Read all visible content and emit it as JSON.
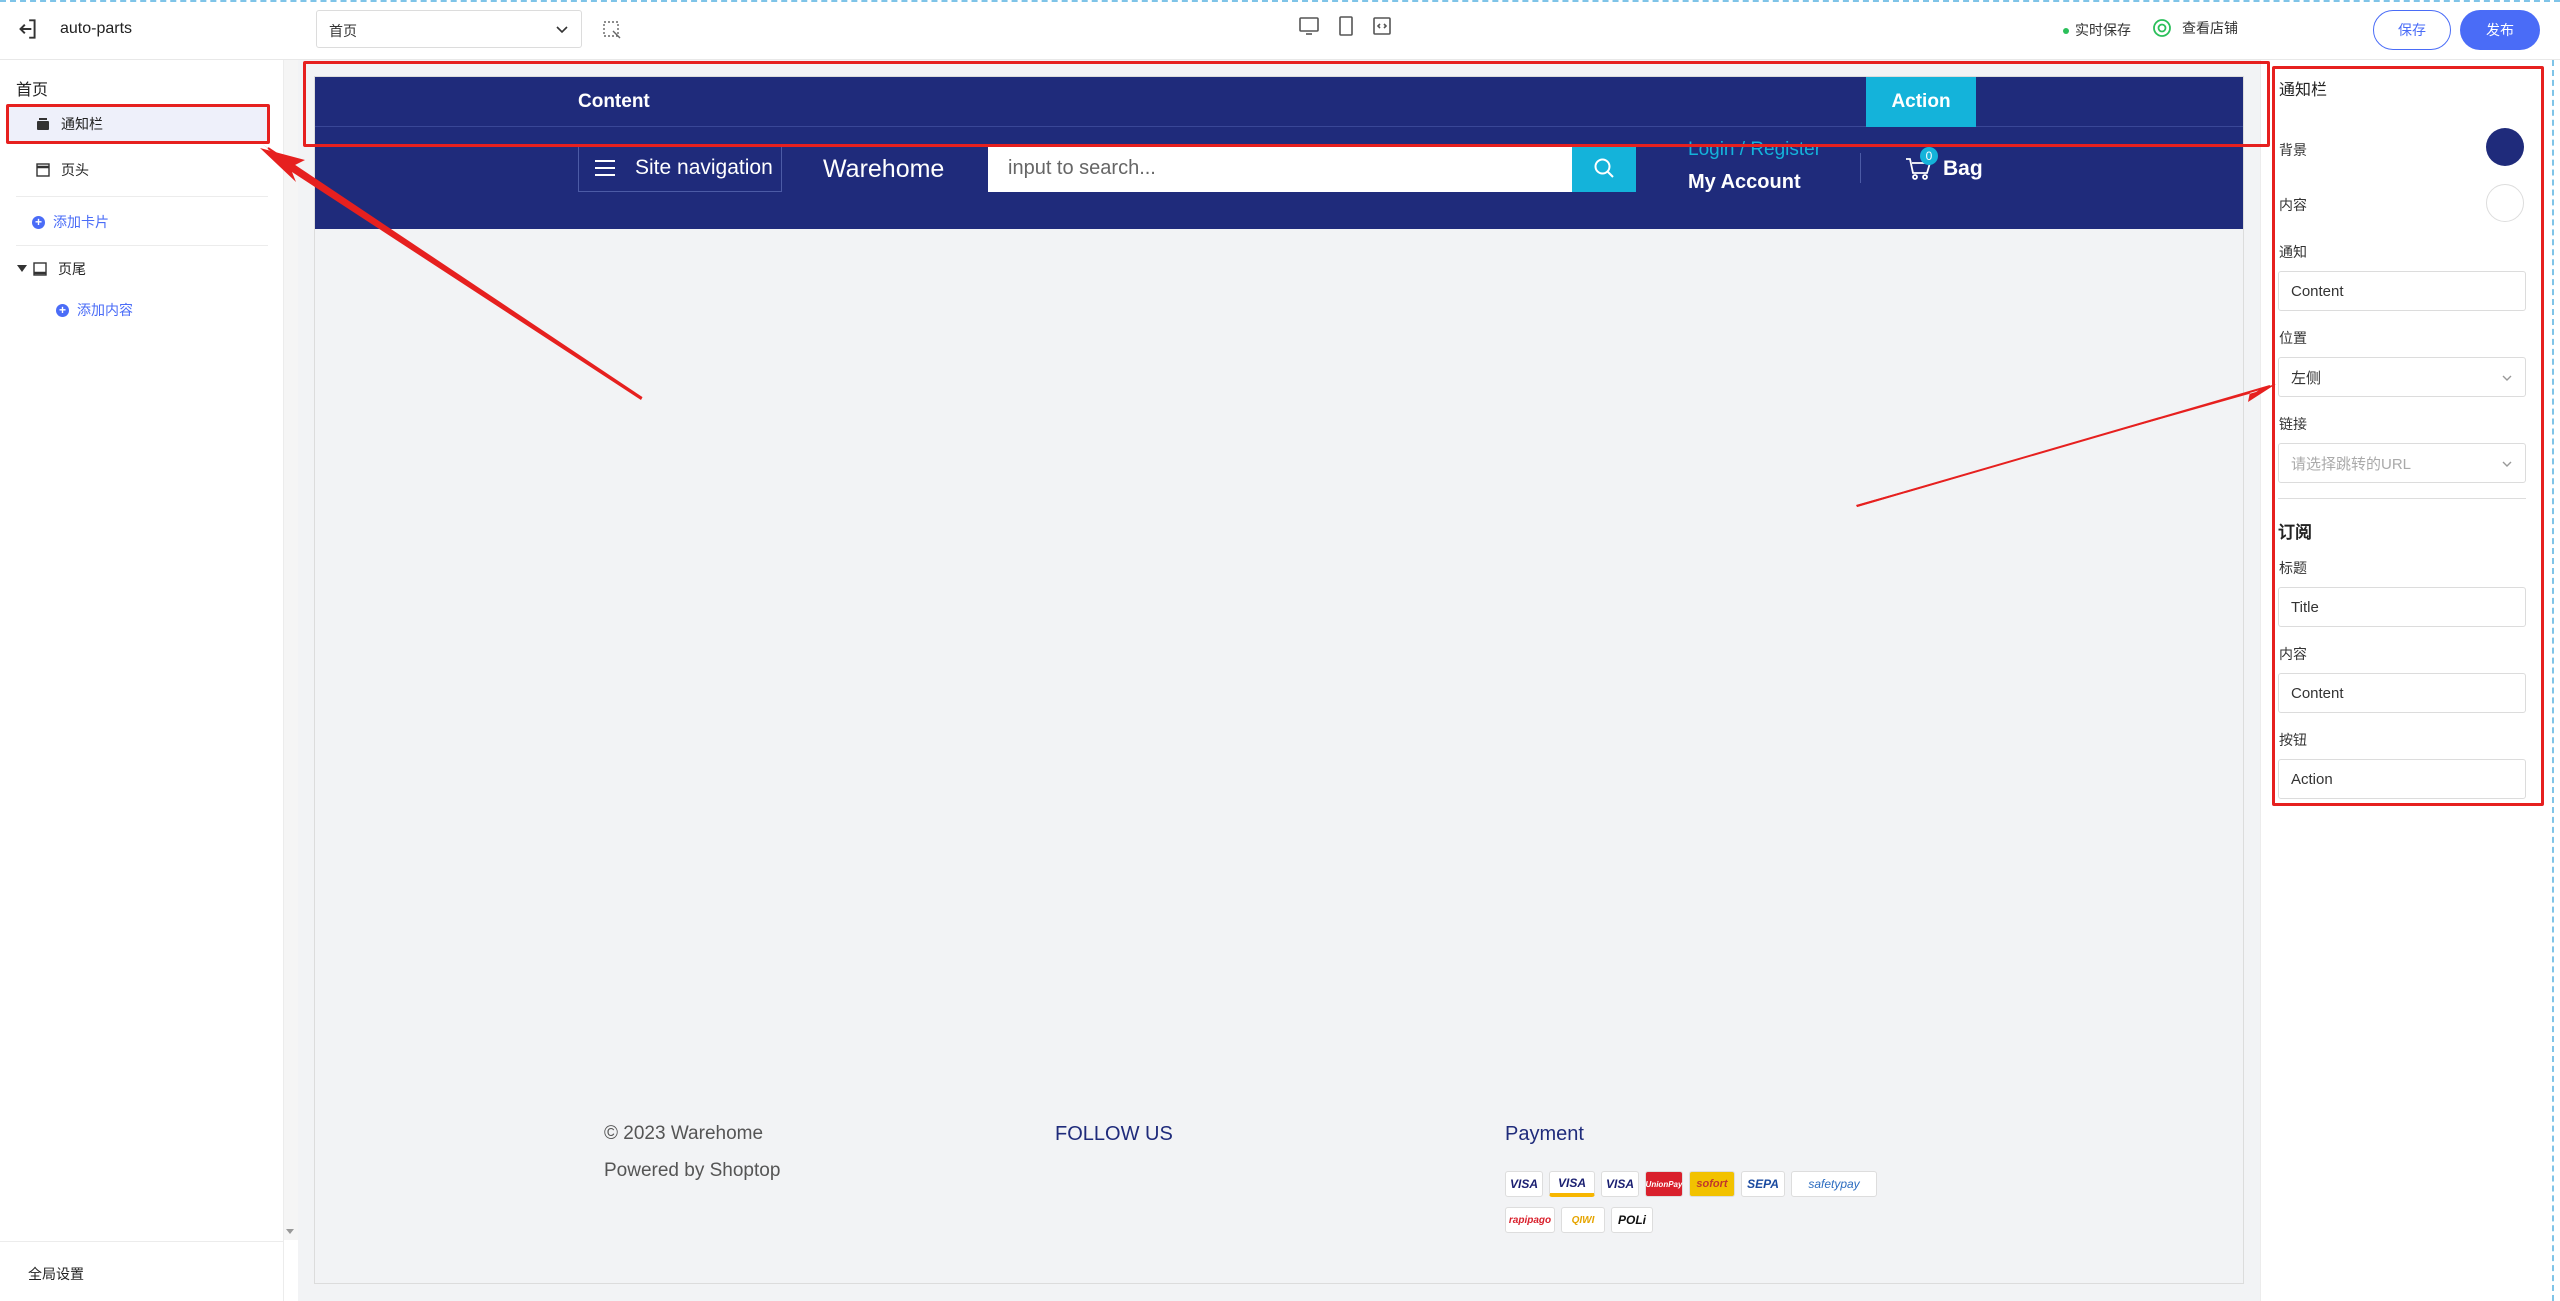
{
  "topbar": {
    "app_title": "auto-parts",
    "page_select": "首页",
    "autosave": "实时保存",
    "view_store": "查看店铺",
    "save": "保存",
    "publish": "发布"
  },
  "left_panel": {
    "breadcrumb": "首页",
    "items": [
      {
        "label": "通知栏",
        "selected": true
      },
      {
        "label": "页头",
        "selected": false
      }
    ],
    "add_card": "添加卡片",
    "footer_group": "页尾",
    "add_content": "添加内容",
    "global_settings": "全局设置"
  },
  "preview": {
    "notice_text": "Content",
    "notice_action": "Action",
    "site_nav": "Site navigation",
    "brand": "Warehome",
    "search_placeholder": "input to search...",
    "login": "Login / Register",
    "account": "My Account",
    "cart_count": "0",
    "bag": "Bag",
    "copyright": "© 2023 Warehome",
    "powered": "Powered by Shoptop",
    "follow": "FOLLOW US",
    "payment": "Payment",
    "payment_methods_row1": [
      "VISA",
      "VISA",
      "VISA",
      "UnionPay",
      "sofort",
      "SEPA",
      "safetypay"
    ],
    "payment_methods_row2": [
      "rapipago",
      "QIWI",
      "POLi"
    ]
  },
  "right_panel": {
    "title": "通知栏",
    "bg_label": "背景",
    "content_label": "内容",
    "notice_label": "通知",
    "notice_value": "Content",
    "position_label": "位置",
    "position_value": "左侧",
    "link_label": "链接",
    "link_placeholder": "请选择跳转的URL",
    "subscribe_heading": "订阅",
    "title_label": "标题",
    "title_value": "Title",
    "content2_label": "内容",
    "content2_value": "Content",
    "button_label": "按钮",
    "button_value": "Action"
  },
  "colors": {
    "navy": "#1f2b7b",
    "cyan": "#14b3da",
    "accent": "#4a6cf7",
    "annotation_red": "#e6201f"
  }
}
